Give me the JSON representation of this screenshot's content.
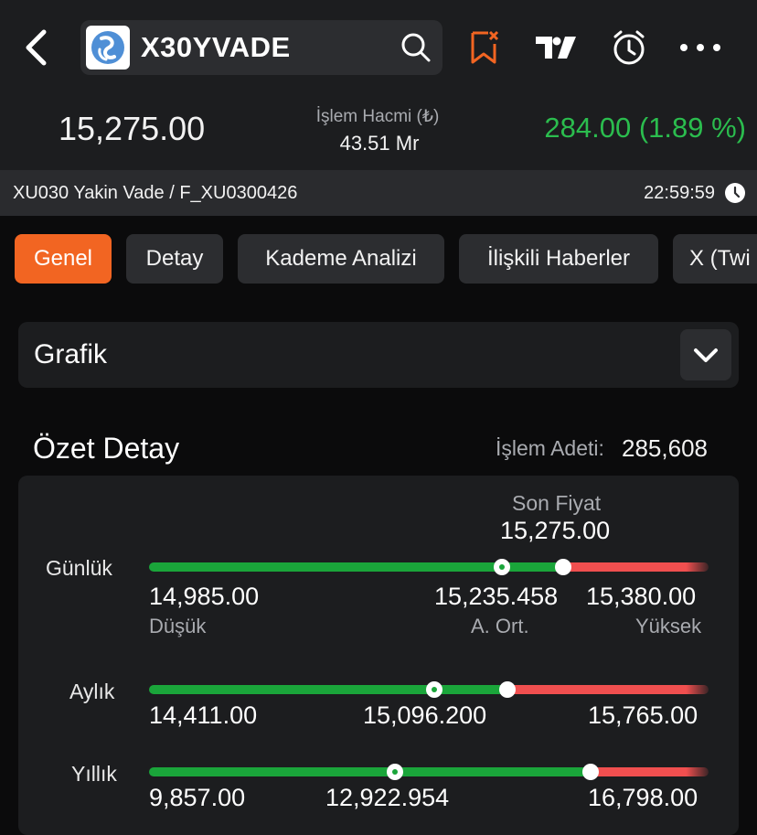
{
  "header": {
    "symbol": "X30YVADE",
    "icons": [
      "back-chevron-icon",
      "app-logo-icon",
      "search-icon",
      "bookmark-remove-icon",
      "tradingview-icon",
      "alarm-icon",
      "more-dots-icon"
    ],
    "last_price": "15,275.00",
    "volume_label": "İşlem Hacmi (₺)",
    "volume_value": "43.51 Mr",
    "change": "284.00 (1.89 %)",
    "description": "XU030 Yakin Vade / F_XU0300426",
    "time": "22:59:59"
  },
  "tabs": [
    "Genel",
    "Detay",
    "Kademe Analizi",
    "İlişkili Haberler",
    "X (Twi"
  ],
  "active_tab": "Genel",
  "grafik": {
    "title": "Grafik"
  },
  "summary": {
    "title": "Özet Detay",
    "trade_count_label": "İşlem Adeti:",
    "trade_count": "285,608",
    "last_price_label": "Son Fiyat",
    "last_price": "15,275.00",
    "ranges": [
      {
        "label": "Günlük",
        "low": "14,985.00",
        "avg": "15,235.458",
        "high": "15,380.00",
        "low_label": "Düşük",
        "avg_label": "A. Ort.",
        "high_label": "Yüksek",
        "avg_position": 0.63,
        "last_position": 0.74
      },
      {
        "label": "Aylık",
        "low": "14,411.00",
        "avg": "15,096.200",
        "high": "15,765.00",
        "avg_position": 0.51,
        "last_position": 0.64
      },
      {
        "label": "Yıllık",
        "low": "9,857.00",
        "avg": "12,922.954",
        "high": "16,798.00",
        "avg_position": 0.44,
        "last_position": 0.79
      }
    ]
  },
  "colors": {
    "accent": "#f26522",
    "up": "#2bbd4e",
    "bar_green": "#1aa53a",
    "bar_red": "#f04f4f",
    "background": "#0b0b0c",
    "panel": "#1c1d1f"
  }
}
